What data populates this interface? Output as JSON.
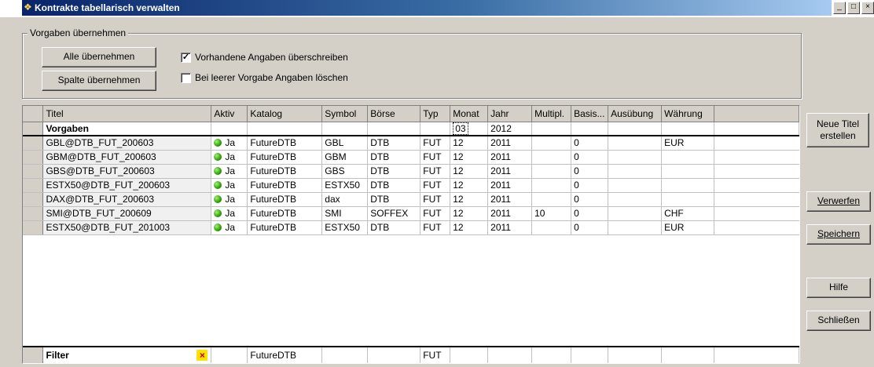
{
  "window": {
    "title": "Kontrakte tabellarisch verwalten",
    "controls": [
      "_",
      "□",
      "×"
    ]
  },
  "vorgaben_group": {
    "legend": "Vorgaben übernehmen",
    "btn_alle": "Alle übernehmen",
    "btn_spalte": "Spalte übernehmen",
    "chk_overwrite": {
      "label": "Vorhandene Angaben überschreiben",
      "checked": true
    },
    "chk_delete": {
      "label": "Bei leerer Vorgabe Angaben löschen",
      "checked": false
    }
  },
  "grid": {
    "columns": [
      "Titel",
      "Aktiv",
      "Katalog",
      "Symbol",
      "Börse",
      "Typ",
      "Monat",
      "Jahr",
      "Multipl.",
      "Basis...",
      "Ausübung",
      "Währung"
    ],
    "vorgaben_row": {
      "label": "Vorgaben",
      "monat": "03",
      "jahr": "2012"
    },
    "rows": [
      {
        "titel": "GBL@DTB_FUT_200603",
        "aktiv": "Ja",
        "katalog": "FutureDTB",
        "symbol": "GBL",
        "boerse": "DTB",
        "typ": "FUT",
        "monat": "12",
        "jahr": "2011",
        "multipl": "",
        "basis": "0",
        "ausuebung": "",
        "waehrung": "EUR"
      },
      {
        "titel": "GBM@DTB_FUT_200603",
        "aktiv": "Ja",
        "katalog": "FutureDTB",
        "symbol": "GBM",
        "boerse": "DTB",
        "typ": "FUT",
        "monat": "12",
        "jahr": "2011",
        "multipl": "",
        "basis": "0",
        "ausuebung": "",
        "waehrung": ""
      },
      {
        "titel": "GBS@DTB_FUT_200603",
        "aktiv": "Ja",
        "katalog": "FutureDTB",
        "symbol": "GBS",
        "boerse": "DTB",
        "typ": "FUT",
        "monat": "12",
        "jahr": "2011",
        "multipl": "",
        "basis": "0",
        "ausuebung": "",
        "waehrung": ""
      },
      {
        "titel": "ESTX50@DTB_FUT_200603",
        "aktiv": "Ja",
        "katalog": "FutureDTB",
        "symbol": "ESTX50",
        "boerse": "DTB",
        "typ": "FUT",
        "monat": "12",
        "jahr": "2011",
        "multipl": "",
        "basis": "0",
        "ausuebung": "",
        "waehrung": ""
      },
      {
        "titel": "DAX@DTB_FUT_200603",
        "aktiv": "Ja",
        "katalog": "FutureDTB",
        "symbol": "dax",
        "boerse": "DTB",
        "typ": "FUT",
        "monat": "12",
        "jahr": "2011",
        "multipl": "",
        "basis": "0",
        "ausuebung": "",
        "waehrung": ""
      },
      {
        "titel": "SMI@DTB_FUT_200609",
        "aktiv": "Ja",
        "katalog": "FutureDTB",
        "symbol": "SMI",
        "boerse": "SOFFEX",
        "typ": "FUT",
        "monat": "12",
        "jahr": "2011",
        "multipl": "10",
        "basis": "0",
        "ausuebung": "",
        "waehrung": "CHF"
      },
      {
        "titel": "ESTX50@DTB_FUT_201003",
        "aktiv": "Ja",
        "katalog": "FutureDTB",
        "symbol": "ESTX50",
        "boerse": "DTB",
        "typ": "FUT",
        "monat": "12",
        "jahr": "2011",
        "multipl": "",
        "basis": "0",
        "ausuebung": "",
        "waehrung": "EUR"
      }
    ],
    "filter_row": {
      "label": "Filter",
      "katalog": "FutureDTB",
      "typ": "FUT"
    }
  },
  "side_buttons": {
    "neue_titel_line1": "Neue Titel",
    "neue_titel_line2": "erstellen",
    "verwerfen": "Verwerfen",
    "speichern": "Speichern",
    "hilfe": "Hilfe",
    "schliessen": "Schließen"
  },
  "colors": {
    "titlebar_start": "#0a246a",
    "titlebar_end": "#a6caf0",
    "window_bg": "#d4d0c8",
    "active_dot": "#2aa000",
    "filter_clear_bg": "#ffe000",
    "filter_clear_fg": "#c00000"
  },
  "icons": {
    "app": "app-icon",
    "active": "green-dot-icon",
    "filter_clear": "close-x-icon"
  }
}
